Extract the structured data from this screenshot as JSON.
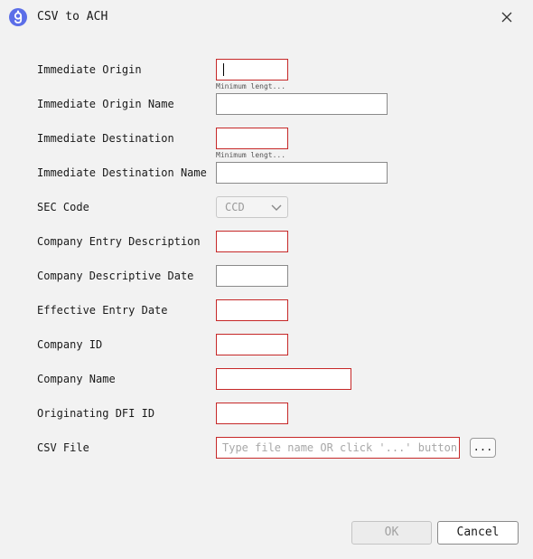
{
  "window": {
    "title": "CSV to ACH",
    "app_icon": "app-logo-icon",
    "close_icon": "close-icon"
  },
  "form": {
    "immediate_origin": {
      "label": "Immediate Origin",
      "value": "",
      "hint": "Minimum lengt..."
    },
    "immediate_origin_name": {
      "label": "Immediate Origin Name",
      "value": ""
    },
    "immediate_destination": {
      "label": "Immediate Destination",
      "value": "",
      "hint": "Minimum lengt..."
    },
    "immediate_destination_name": {
      "label": "Immediate Destination Name",
      "value": ""
    },
    "sec_code": {
      "label": "SEC Code",
      "value": "CCD"
    },
    "company_entry_description": {
      "label": "Company Entry Description",
      "value": ""
    },
    "company_descriptive_date": {
      "label": "Company Descriptive Date",
      "value": ""
    },
    "effective_entry_date": {
      "label": "Effective Entry Date",
      "value": ""
    },
    "company_id": {
      "label": "Company ID",
      "value": ""
    },
    "company_name": {
      "label": "Company Name",
      "value": ""
    },
    "originating_dfi_id": {
      "label": "Originating DFI ID",
      "value": ""
    },
    "csv_file": {
      "label": "CSV File",
      "value": "",
      "placeholder": "Type file name OR click '...' button",
      "browse_label": "..."
    }
  },
  "buttons": {
    "ok_label": "OK",
    "cancel_label": "Cancel"
  },
  "colors": {
    "invalid_border": "#c62828",
    "accent": "#5b6ee8"
  }
}
